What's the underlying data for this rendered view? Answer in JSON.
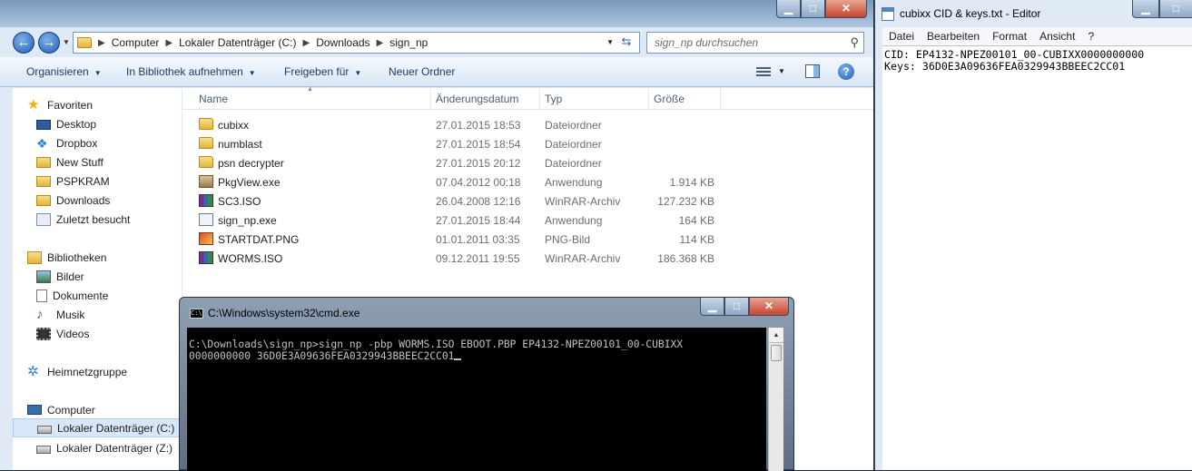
{
  "explorer": {
    "breadcrumb": [
      "Computer",
      "Lokaler Datenträger (C:)",
      "Downloads",
      "sign_np"
    ],
    "search_placeholder": "sign_np durchsuchen",
    "window_buttons": {
      "minimize": "▁",
      "maximize": "□",
      "close": "✕"
    },
    "toolbar": {
      "organize": "Organisieren",
      "include_library": "In Bibliothek aufnehmen",
      "share": "Freigeben für",
      "new_folder": "Neuer Ordner"
    },
    "sidebar": {
      "favorites": "Favoriten",
      "favorite_items": [
        "Desktop",
        "Dropbox",
        "New Stuff",
        "PSPKRAM",
        "Downloads",
        "Zuletzt besucht"
      ],
      "libraries": "Bibliotheken",
      "library_items": [
        "Bilder",
        "Dokumente",
        "Musik",
        "Videos"
      ],
      "homegroup": "Heimnetzgruppe",
      "computer": "Computer",
      "computer_items": [
        "Lokaler Datenträger (C:)",
        "Lokaler Datenträger (Z:)"
      ]
    },
    "columns": {
      "name": "Name",
      "date": "Änderungsdatum",
      "type": "Typ",
      "size": "Größe"
    },
    "files": [
      {
        "icon": "folder-icon",
        "name": "cubixx",
        "date": "27.01.2015 18:53",
        "type": "Dateiordner",
        "size": ""
      },
      {
        "icon": "folder-icon",
        "name": "numblast",
        "date": "27.01.2015 18:54",
        "type": "Dateiordner",
        "size": ""
      },
      {
        "icon": "folder-icon",
        "name": "psn decrypter",
        "date": "27.01.2015 20:12",
        "type": "Dateiordner",
        "size": ""
      },
      {
        "icon": "package-icon",
        "name": "PkgView.exe",
        "date": "07.04.2012 00:18",
        "type": "Anwendung",
        "size": "1.914 KB"
      },
      {
        "icon": "winrar-icon",
        "name": "SC3.ISO",
        "date": "26.04.2008 12:16",
        "type": "WinRAR-Archiv",
        "size": "127.232 KB"
      },
      {
        "icon": "application-icon",
        "name": "sign_np.exe",
        "date": "27.01.2015 18:44",
        "type": "Anwendung",
        "size": "164 KB"
      },
      {
        "icon": "png-image-icon",
        "name": "STARTDAT.PNG",
        "date": "01.01.2011 03:35",
        "type": "PNG-Bild",
        "size": "114 KB"
      },
      {
        "icon": "winrar-icon",
        "name": "WORMS.ISO",
        "date": "09.12.2011 19:55",
        "type": "WinRAR-Archiv",
        "size": "186.368 KB"
      }
    ]
  },
  "cmd": {
    "title": "C:\\Windows\\system32\\cmd.exe",
    "title_icon_text": "C:\\",
    "lines": [
      "C:\\Downloads\\sign_np>sign_np -pbp WORMS.ISO EBOOT.PBP EP4132-NPEZ00101_00-CUBIXX",
      "0000000000 36D0E3A09636FEA0329943BBEEC2CC01"
    ]
  },
  "notepad": {
    "title": "cubixx CID & keys.txt - Editor",
    "menu": [
      "Datei",
      "Bearbeiten",
      "Format",
      "Ansicht",
      "?"
    ],
    "lines": [
      "CID: EP4132-NPEZ00101_00-CUBIXX0000000000",
      "Keys: 36D0E3A09636FEA0329943BBEEC2CC01"
    ]
  }
}
